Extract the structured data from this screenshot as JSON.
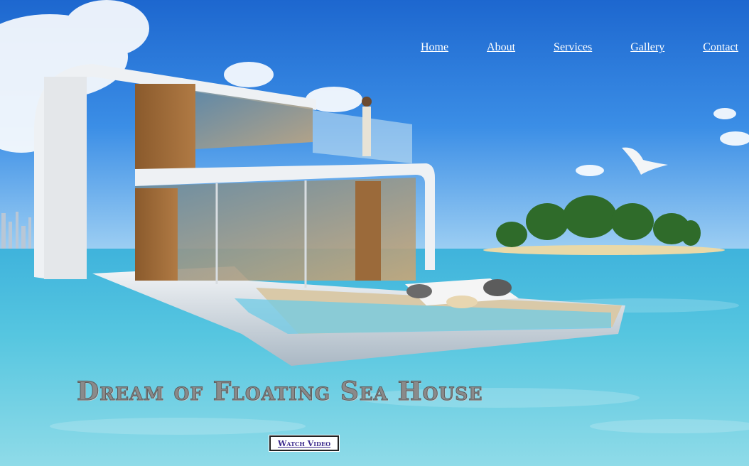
{
  "nav": {
    "items": [
      {
        "label": "Home"
      },
      {
        "label": "About"
      },
      {
        "label": "Services"
      },
      {
        "label": "Gallery"
      },
      {
        "label": "Contact"
      }
    ]
  },
  "hero": {
    "title": "Dream of Floating Sea House",
    "cta_label": "Watch Video"
  },
  "colors": {
    "sky_top": "#1f6fd6",
    "sea": "#3fb7d8",
    "nav_text": "#ffffff",
    "title_text": "#8a8a8a",
    "cta_text": "#3b2a8c"
  }
}
